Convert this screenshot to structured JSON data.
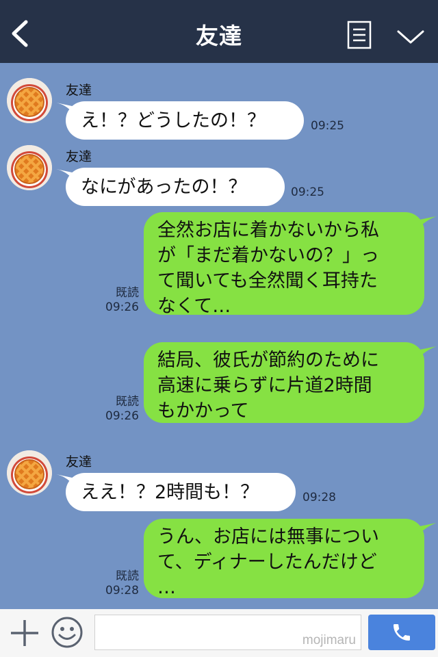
{
  "header": {
    "title": "友達"
  },
  "contact": {
    "name": "友達"
  },
  "messages": [
    {
      "dir": "in",
      "text": "え！？どうしたの！？",
      "time": "09:25"
    },
    {
      "dir": "in",
      "text": "なにがあったの！？",
      "time": "09:25"
    },
    {
      "dir": "out",
      "text": "全然お店に着かないから私\nが「まだ着かないの？」っ\nて聞いても全然聞く耳持た\nなくて…",
      "read": "既読",
      "time": "09:26"
    },
    {
      "dir": "out",
      "text": "結局、彼氏が節約のために\n高速に乗らずに片道2時間\nもかかって",
      "read": "既読",
      "time": "09:26"
    },
    {
      "dir": "in",
      "text": "ええ！？2時間も！？",
      "time": "09:28"
    },
    {
      "dir": "out",
      "text": "うん、お店には無事につい\nて、ディナーしたんだけど\n…",
      "read": "既読",
      "time": "09:28"
    }
  ],
  "composer": {
    "placeholder": "",
    "watermark": "mojimaru"
  },
  "icons": {
    "back": "back-arrow-icon",
    "menu": "note-menu-icon",
    "down": "chevron-down-icon",
    "plus": "plus-icon",
    "emoji": "smiley-icon",
    "send": "phone-icon",
    "avatar": "pie-avatar"
  },
  "colors": {
    "header": "#263248",
    "chat_bg": "#7393c4",
    "outgoing": "#86e143",
    "incoming": "#ffffff",
    "send_button": "#4a83dd"
  }
}
